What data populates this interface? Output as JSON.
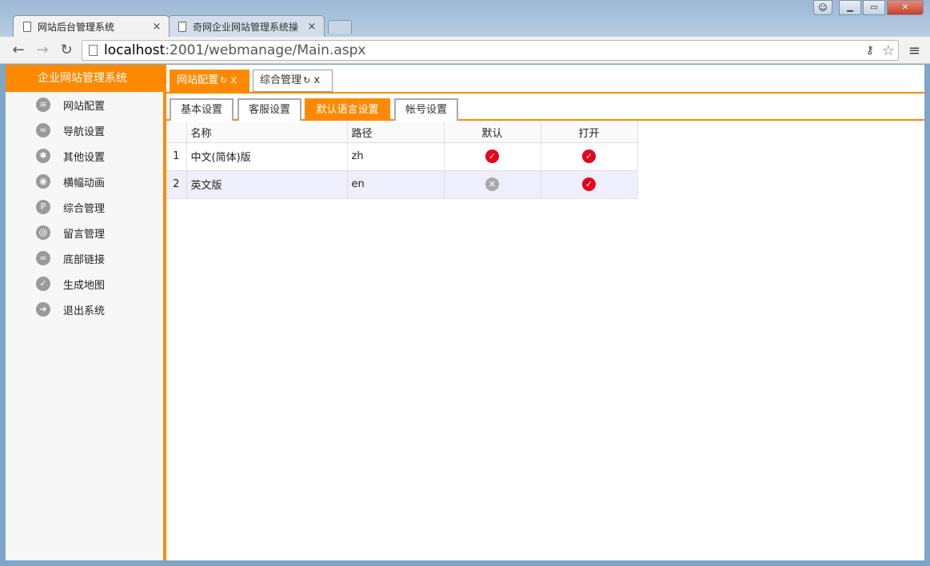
{
  "browser": {
    "tabs": [
      {
        "title": "网站后台管理系统",
        "active": true
      },
      {
        "title": "奇网企业网站管理系统操"
      }
    ],
    "url_host": "localhost",
    "url_path": ":2001/webmanage/Main.aspx"
  },
  "sidebar": {
    "title": "企业网站管理系统",
    "items": [
      {
        "label": "网站配置",
        "icon": "config-icon"
      },
      {
        "label": "导航设置",
        "icon": "link-icon"
      },
      {
        "label": "其他设置",
        "icon": "gear-icon"
      },
      {
        "label": "横幅动画",
        "icon": "camera-icon"
      },
      {
        "label": "综合管理",
        "icon": "p-icon"
      },
      {
        "label": "留言管理",
        "icon": "at-icon"
      },
      {
        "label": "底部链接",
        "icon": "link-icon"
      },
      {
        "label": "生成地图",
        "icon": "check-icon"
      },
      {
        "label": "退出系统",
        "icon": "arrow-right-icon"
      }
    ]
  },
  "top_tabs": [
    {
      "label": "网站配置",
      "close": "x"
    },
    {
      "label": "综合管理",
      "close": "x"
    }
  ],
  "sub_tabs": [
    {
      "label": "基本设置"
    },
    {
      "label": "客服设置"
    },
    {
      "label": "默认语言设置",
      "active": true
    },
    {
      "label": "帐号设置"
    }
  ],
  "table": {
    "headers": [
      "名称",
      "路径",
      "默认",
      "打开"
    ],
    "rows": [
      {
        "index": "1",
        "name": "中文(简体)版",
        "path": "zh",
        "default": true,
        "open": true
      },
      {
        "index": "2",
        "name": "英文版",
        "path": "en",
        "default": false,
        "open": true
      }
    ]
  },
  "colors": {
    "accent": "#ff8a00",
    "check": "#e8001c",
    "cross": "#a9a9a9"
  }
}
